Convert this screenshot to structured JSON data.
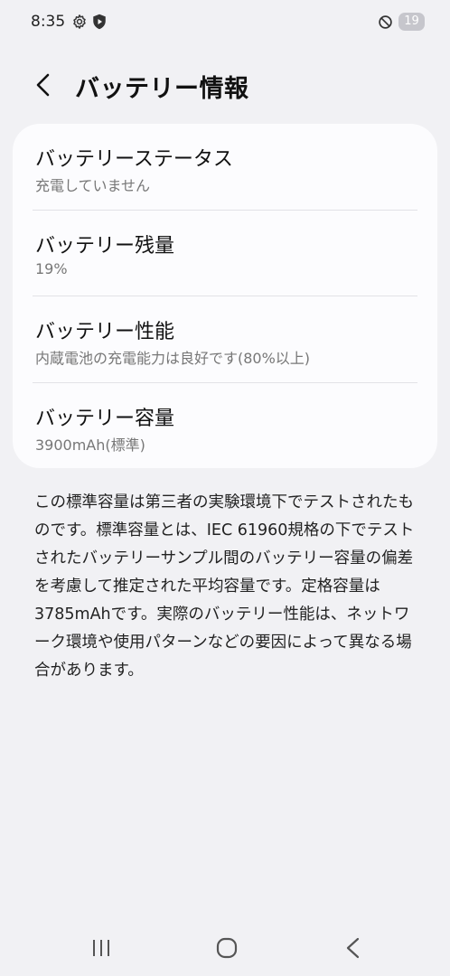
{
  "status_bar": {
    "time": "8:35",
    "battery_level": "19",
    "icons": [
      "gear-icon",
      "shield-icon",
      "do-not-disturb-icon",
      "battery-icon"
    ]
  },
  "header": {
    "title": "バッテリー情報",
    "back_icon": "chevron-left-icon"
  },
  "battery_info": {
    "items": [
      {
        "title": "バッテリーステータス",
        "value": "充電していません"
      },
      {
        "title": "バッテリー残量",
        "value": "19%"
      },
      {
        "title": "バッテリー性能",
        "value": "内蔵電池の充電能力は良好です(80%以上)"
      },
      {
        "title": "バッテリー容量",
        "value": "3900mAh(標準)"
      }
    ]
  },
  "note": {
    "text": "この標準容量は第三者の実験環境下でテストされたものです。標準容量とは、IEC 61960規格の下でテストされたバッテリーサンプル間のバッテリー容量の偏差を考慮して推定された平均容量です。定格容量は3785mAhです。実際のバッテリー性能は、ネットワーク環境や使用パターンなどの要因によって異なる場合があります。"
  },
  "nav_bar": {
    "icons": [
      "recents-icon",
      "home-icon",
      "back-icon"
    ]
  }
}
